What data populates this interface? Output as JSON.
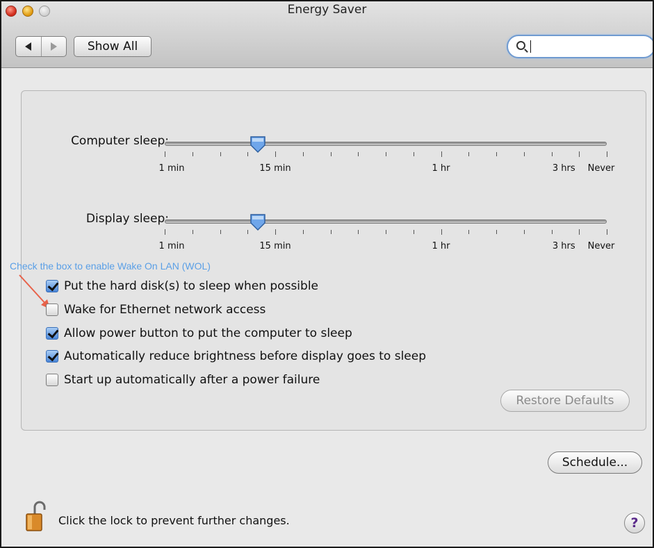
{
  "window": {
    "title": "Energy Saver"
  },
  "toolbar": {
    "back_icon": "back-arrow-icon",
    "forward_icon": "forward-arrow-icon",
    "show_all_label": "Show All",
    "search_value": "",
    "search_icon": "magnifier-icon"
  },
  "sleep": {
    "computer": {
      "label": "Computer sleep:",
      "value": "10 min",
      "value_fraction": 0.21
    },
    "display": {
      "label": "Display sleep:",
      "value": "10 min",
      "value_fraction": 0.21
    },
    "tick_labels": [
      "1 min",
      "15 min",
      "1 hr",
      "3 hrs",
      "Never"
    ]
  },
  "annotation": {
    "text": "Check the box to enable Wake On LAN (WOL)",
    "color": "#5a9fe6",
    "arrow_color": "#e8624a"
  },
  "options": [
    {
      "label": "Put the hard disk(s) to sleep when possible",
      "checked": true
    },
    {
      "label": "Wake for Ethernet network access",
      "checked": false
    },
    {
      "label": "Allow power button to put the computer to sleep",
      "checked": true
    },
    {
      "label": "Automatically reduce brightness before display goes to sleep",
      "checked": true
    },
    {
      "label": "Start up automatically after a power failure",
      "checked": false
    }
  ],
  "buttons": {
    "restore_defaults": "Restore Defaults",
    "schedule": "Schedule..."
  },
  "footer": {
    "lock_text": "Click the lock to prevent further changes.",
    "lock_icon": "open-lock-icon",
    "help_label": "?"
  },
  "colors": {
    "accent": "#4a86d8",
    "panel": "#e4e4e4"
  }
}
